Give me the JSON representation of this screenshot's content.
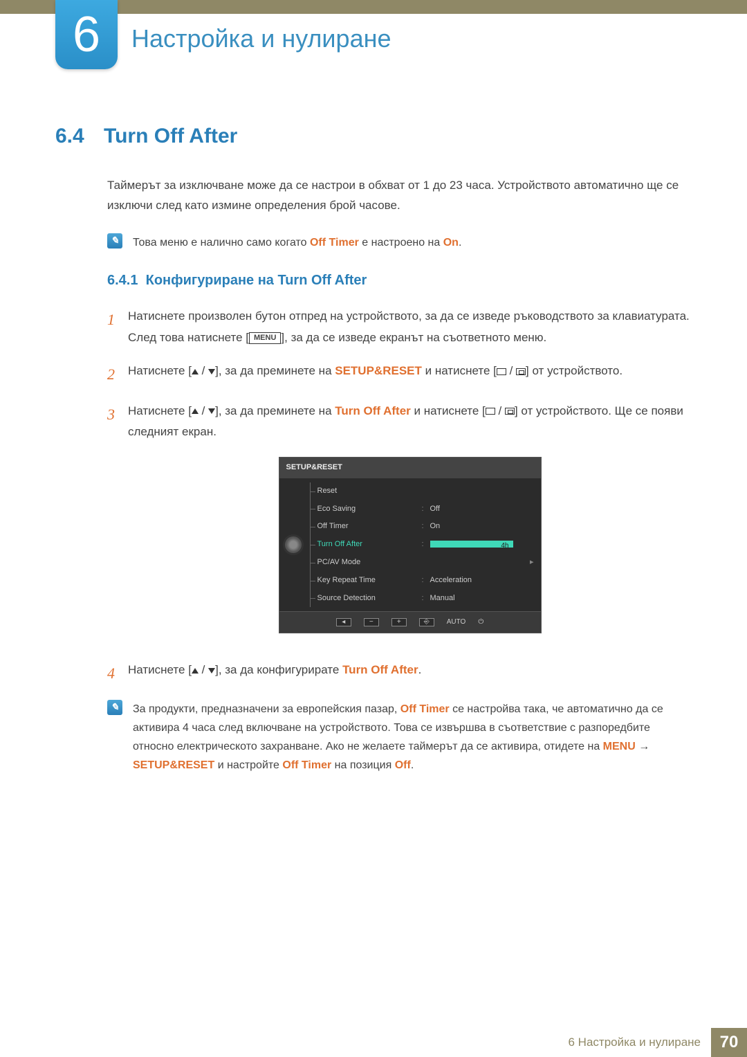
{
  "chapter": {
    "number": "6",
    "title": "Настройка и нулиране"
  },
  "section": {
    "number": "6.4",
    "title": "Turn Off After"
  },
  "intro": "Таймерът за изключване може да се настрои в обхват от 1 до 23 часа. Устройството автоматично ще се изключи след като измине определения брой часове.",
  "note1": {
    "pre": "Това меню е налично само когато ",
    "t1": "Off Timer",
    "mid": " е настроено на ",
    "t2": "On",
    "post": "."
  },
  "subsection": {
    "number": "6.4.1",
    "title": "Конфигуриране на Turn Off After"
  },
  "steps": {
    "s1": {
      "a": "Натиснете произволен бутон отпред на устройството, за да се изведе ръководството за клавиатурата. След това натиснете [",
      "menu": "MENU",
      "b": "], за да се изведе екранът на съответното меню."
    },
    "s2": {
      "a": "Натиснете [",
      "b": "], за да преминете на ",
      "target": "SETUP&RESET",
      "c": " и натиснете [",
      "d": "] от устройството."
    },
    "s3": {
      "a": "Натиснете [",
      "b": "], за да преминете на ",
      "target": "Turn Off After",
      "c": " и натиснете [",
      "d": "] от устройството. Ще се появи следният екран."
    },
    "s4": {
      "a": "Натиснете [",
      "b": "], за да конфигурирате ",
      "target": "Turn Off After",
      "c": "."
    }
  },
  "osd": {
    "title": "SETUP&RESET",
    "rows": [
      {
        "label": "Reset",
        "val": ""
      },
      {
        "label": "Eco Saving",
        "val": "Off"
      },
      {
        "label": "Off Timer",
        "val": "On"
      },
      {
        "label": "Turn Off After",
        "val": "4h",
        "active": true
      },
      {
        "label": "PC/AV Mode",
        "val": ""
      },
      {
        "label": "Key Repeat Time",
        "val": "Acceleration"
      },
      {
        "label": "Source Detection",
        "val": "Manual"
      }
    ],
    "auto": "AUTO"
  },
  "note2": {
    "a": "За продукти, предназначени за европейския пазар, ",
    "t1": "Off Timer",
    "b": " се настройва така, че автоматично да се активира 4 часа след включване на устройството. Това се извършва в съответствие с разпоредбите относно електрическото захранване. Ако не желаете таймерът да се активира, отидете на ",
    "t2": "MENU",
    "arrow": " → ",
    "t3": "SETUP&RESET",
    "c": " и настройте ",
    "t4": "Off Timer",
    "d": " на позиция ",
    "t5": "Off",
    "e": "."
  },
  "footer": {
    "label": "6 Настройка и нулиране",
    "page": "70"
  }
}
